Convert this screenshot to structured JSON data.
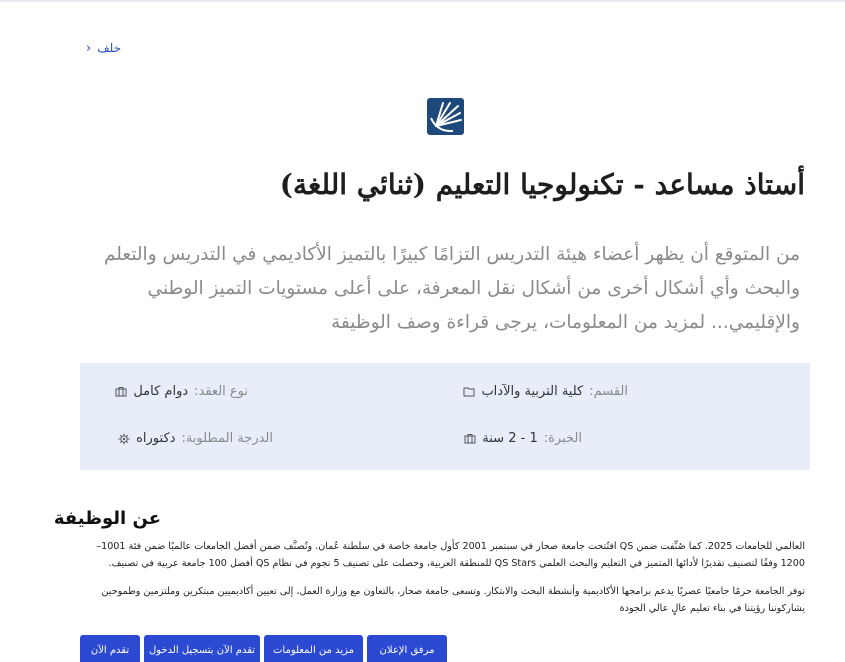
{
  "nav": {
    "back_label": "خلف"
  },
  "job": {
    "title": "أستاذ مساعد - تكنولوجيا التعليم (ثنائي اللغة)",
    "intro": "من المتوقع أن يظهر أعضاء هيئة التدريس التزامًا كبيرًا بالتميز الأكاديمي في التدريس والتعلم والبحث وأي أشكال أخرى من أشكال نقل المعرفة، على أعلى مستويات التميز الوطني والإقليمي... لمزيد من المعلومات، يرجى قراءة وصف الوظيفة"
  },
  "info": {
    "department": {
      "label": "القسم:",
      "value": "كلية التربية والآداب",
      "icon": "folder-icon"
    },
    "contract": {
      "label": "نوع العقد:",
      "value": "دوام كامل",
      "icon": "briefcase-icon"
    },
    "experience": {
      "label": "الخبرة:",
      "value": "1 - 2 سنة",
      "icon": "briefcase-icon"
    },
    "degree": {
      "label": "الدرجة المطلوبة:",
      "value": "دكتوراه",
      "icon": "gear-icon"
    }
  },
  "about": {
    "heading": "عن الوظيفة",
    "paragraph1": "العالمي للجامعات 2025. كما صُنِّفت ضمن QS افتُتحت جامعة صحار في سبتمبر 2001 كأول جامعة خاصة في سلطنة عُمان. وتُصنَّف ضمن أفضل الجامعات عالميًا ضمن فئة 1001–1200 وفقًا لتصنيف تقديرًا لأدائها المتميز في التعليم والبحث العلمي QS Stars للمنطقة العربية، وحصلت على تصنيف 5 نجوم في نظام QS أفضل 100 جامعة عربية في تصنيف.",
    "paragraph2": "توفر الجامعة حرمًا جامعيًا عصريًا يدعم برامجها الأكاديمية وأنشطة البحث والابتكار. وتسعى جامعة صحار، بالتعاون مع وزارة العمل، إلى تعيين أكاديميين مبتكرين وملتزمين وطموحين يشاركوننا رؤيتنا في بناء تعليم عالٍ عالي الجودة"
  },
  "actions": {
    "apply": "تقدم الآن",
    "apply_login": "تقدم الآن بتسجيل الدخول",
    "more_info": "مزيد من المعلومات",
    "attachment": "مرفق الإعلان"
  },
  "colors": {
    "accent": "#2b4ad1",
    "info_bg": "#e8edfa",
    "logo": "#1d4a7a"
  }
}
